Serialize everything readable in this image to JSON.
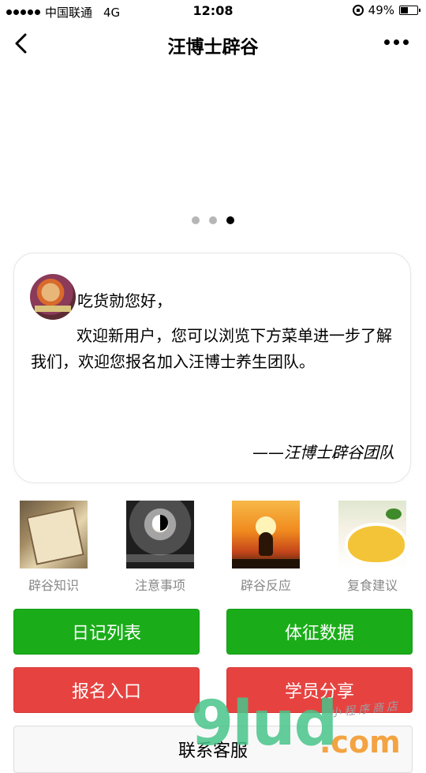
{
  "status_bar": {
    "carrier": "中国联通",
    "network": "4G",
    "time": "12:08",
    "battery": "49%",
    "battery_level": 0.49
  },
  "nav": {
    "title": "汪博士辟谷"
  },
  "banner": {
    "slide_count": 3,
    "active_index": 2
  },
  "card": {
    "greeting": "吃货勍您好，",
    "message": "欢迎新用户，您可以浏览下方菜单进一步了解我们，欢迎您报名加入汪博士养生团队。",
    "signature": "——汪博士辟谷团队"
  },
  "categories": [
    {
      "label": "辟谷知识",
      "icon": "book-image"
    },
    {
      "label": "注意事项",
      "icon": "meditation-image"
    },
    {
      "label": "辟谷反应",
      "icon": "sunset-yoga-image"
    },
    {
      "label": "复食建议",
      "icon": "porridge-image"
    }
  ],
  "buttons": {
    "diary": "日记列表",
    "vitals": "体征数据",
    "signup": "报名入口",
    "share": "学员分享",
    "support": "联系客服"
  },
  "colors": {
    "green_button": "#1aad19",
    "red_button": "#e64340"
  },
  "watermark": {
    "main": "9lud",
    "suffix": ".com",
    "small": "小程序商店"
  }
}
